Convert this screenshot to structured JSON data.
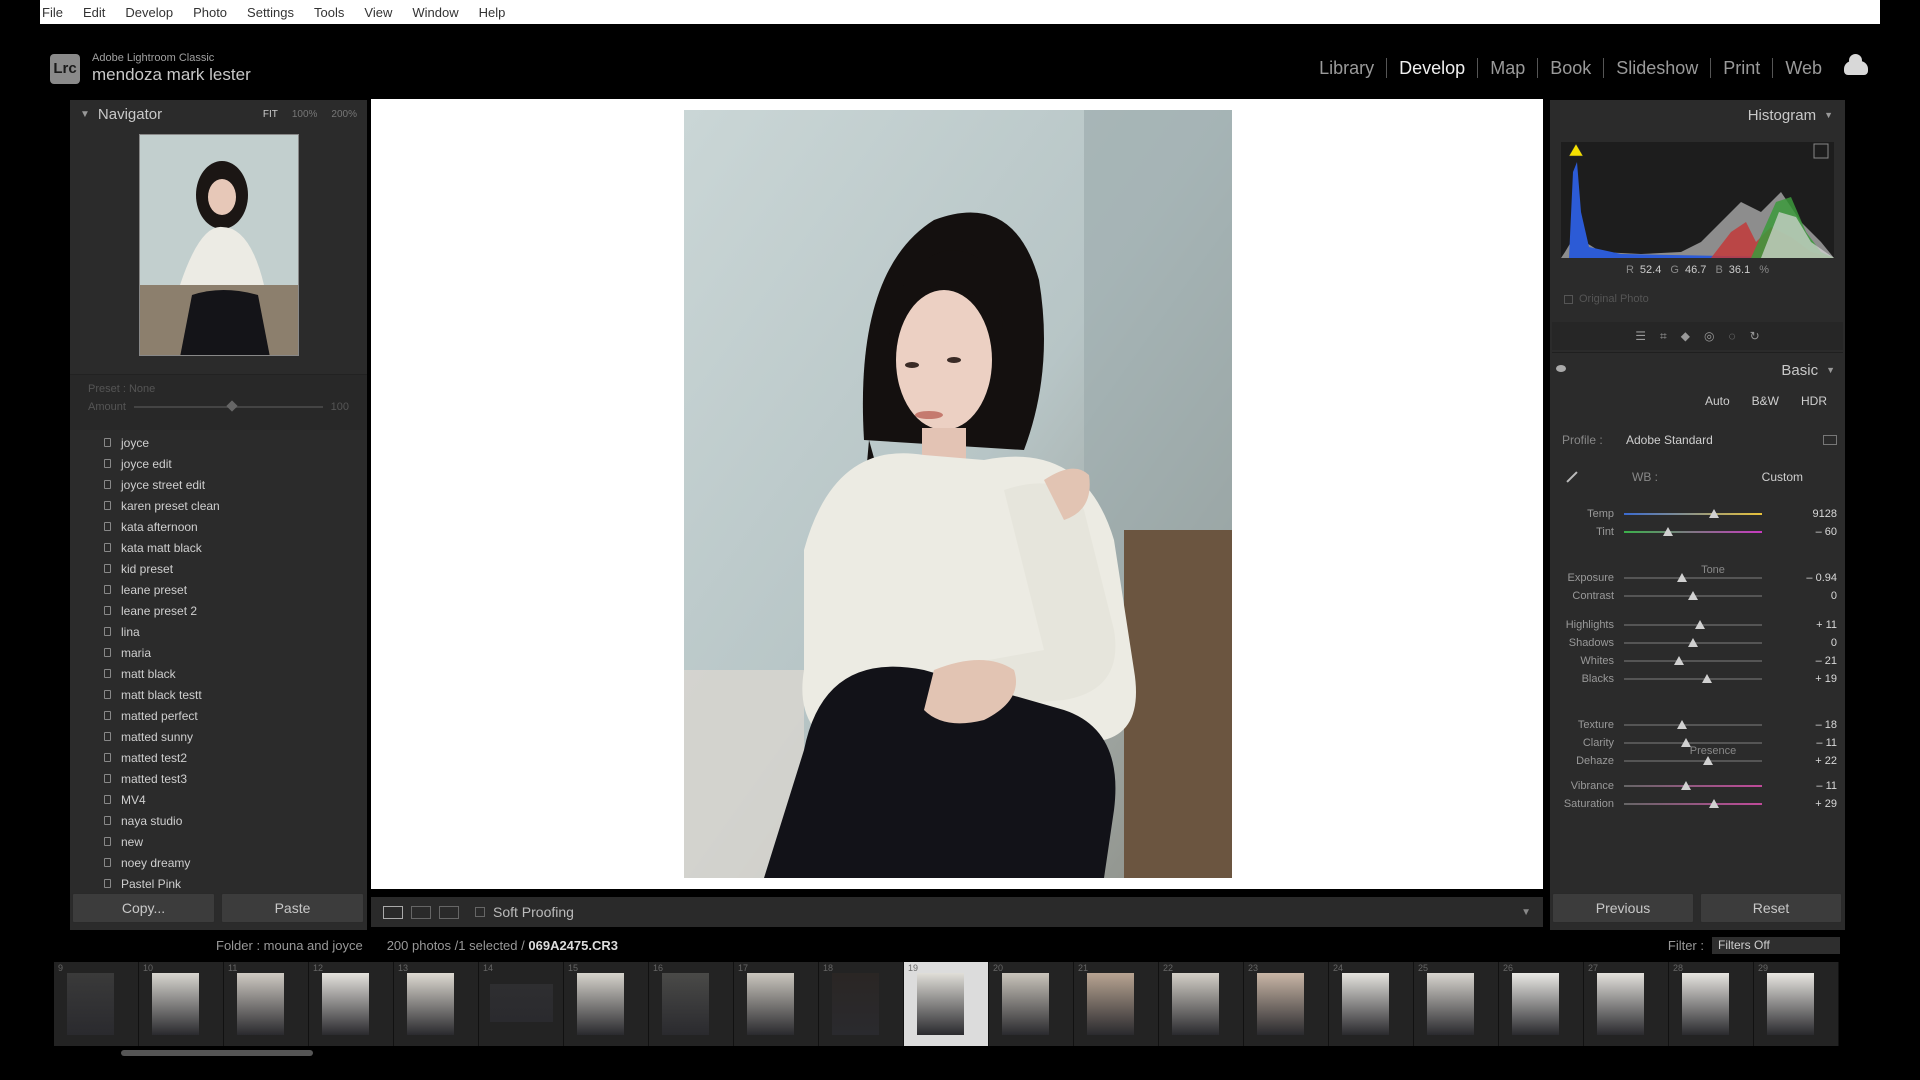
{
  "menu": [
    "File",
    "Edit",
    "Develop",
    "Photo",
    "Settings",
    "Tools",
    "View",
    "Window",
    "Help"
  ],
  "identity": {
    "logo": "Lrc",
    "app": "Adobe Lightroom Classic",
    "user": "mendoza mark lester"
  },
  "modules": [
    "Library",
    "Develop",
    "Map",
    "Book",
    "Slideshow",
    "Print",
    "Web"
  ],
  "active_module": "Develop",
  "navigator": {
    "title": "Navigator",
    "zooms": [
      "FIT",
      "100%",
      "200%"
    ]
  },
  "preset_amount": {
    "preset_label": "Preset : None",
    "amount_label": "Amount",
    "amount_value": "100"
  },
  "presets": [
    "joyce",
    "joyce edit",
    "joyce street edit",
    "karen preset clean",
    "kata afternoon",
    "kata matt black",
    "kid preset",
    "leane preset",
    "leane preset 2",
    "lina",
    "maria",
    "matt black",
    "matt black testt",
    "matted perfect",
    "matted sunny",
    "matted test2",
    "matted test3",
    "MV4",
    "naya studio",
    "new",
    "noey dreamy",
    "Pastel Pink"
  ],
  "left_buttons": {
    "copy": "Copy...",
    "paste": "Paste"
  },
  "toolbar": {
    "soft_proofing": "Soft Proofing"
  },
  "histogram": {
    "title": "Histogram",
    "r_label": "R",
    "r": "52.4",
    "g_label": "G",
    "g": "46.7",
    "b_label": "B",
    "b": "36.1",
    "pct": "%",
    "original_photo": "Original Photo"
  },
  "basic": {
    "title": "Basic",
    "treatment": [
      "Auto",
      "B&W",
      "HDR"
    ],
    "profile_label": "Profile :",
    "profile_value": "Adobe Standard",
    "wb_label": "WB :",
    "wb_value": "Custom",
    "tone_label": "Tone",
    "presence_label": "Presence",
    "sliders": [
      {
        "label": "Temp",
        "value": "9128",
        "pos": 0.65
      },
      {
        "label": "Tint",
        "value": "– 60",
        "pos": 0.32
      },
      {
        "label": "Exposure",
        "value": "– 0.94",
        "pos": 0.42
      },
      {
        "label": "Contrast",
        "value": "0",
        "pos": 0.5
      },
      {
        "label": "Highlights",
        "value": "+ 11",
        "pos": 0.55
      },
      {
        "label": "Shadows",
        "value": "0",
        "pos": 0.5
      },
      {
        "label": "Whites",
        "value": "– 21",
        "pos": 0.4
      },
      {
        "label": "Blacks",
        "value": "+ 19",
        "pos": 0.6
      },
      {
        "label": "Texture",
        "value": "– 18",
        "pos": 0.42
      },
      {
        "label": "Clarity",
        "value": "– 11",
        "pos": 0.45
      },
      {
        "label": "Dehaze",
        "value": "+ 22",
        "pos": 0.61
      },
      {
        "label": "Vibrance",
        "value": "– 11",
        "pos": 0.45
      },
      {
        "label": "Saturation",
        "value": "+ 29",
        "pos": 0.65
      }
    ]
  },
  "right_buttons": {
    "previous": "Previous",
    "reset": "Reset"
  },
  "filmstrip": {
    "source": "Folder : mouna and joyce",
    "count_prefix": "200 photos /1 selected /",
    "selected_file": "069A2475.CR3",
    "filter_label": "Filter :",
    "filter_value": "Filters Off",
    "numbers": [
      "9",
      "10",
      "11",
      "12",
      "13",
      "14",
      "15",
      "16",
      "17",
      "18",
      "19",
      "20",
      "21",
      "22",
      "23",
      "24",
      "25",
      "26",
      "27",
      "28",
      "29"
    ],
    "selected_index": 10
  },
  "colors": {
    "accent": "#f0f0f0",
    "panel": "#2b2b2b",
    "canvas": "#ffffff"
  }
}
